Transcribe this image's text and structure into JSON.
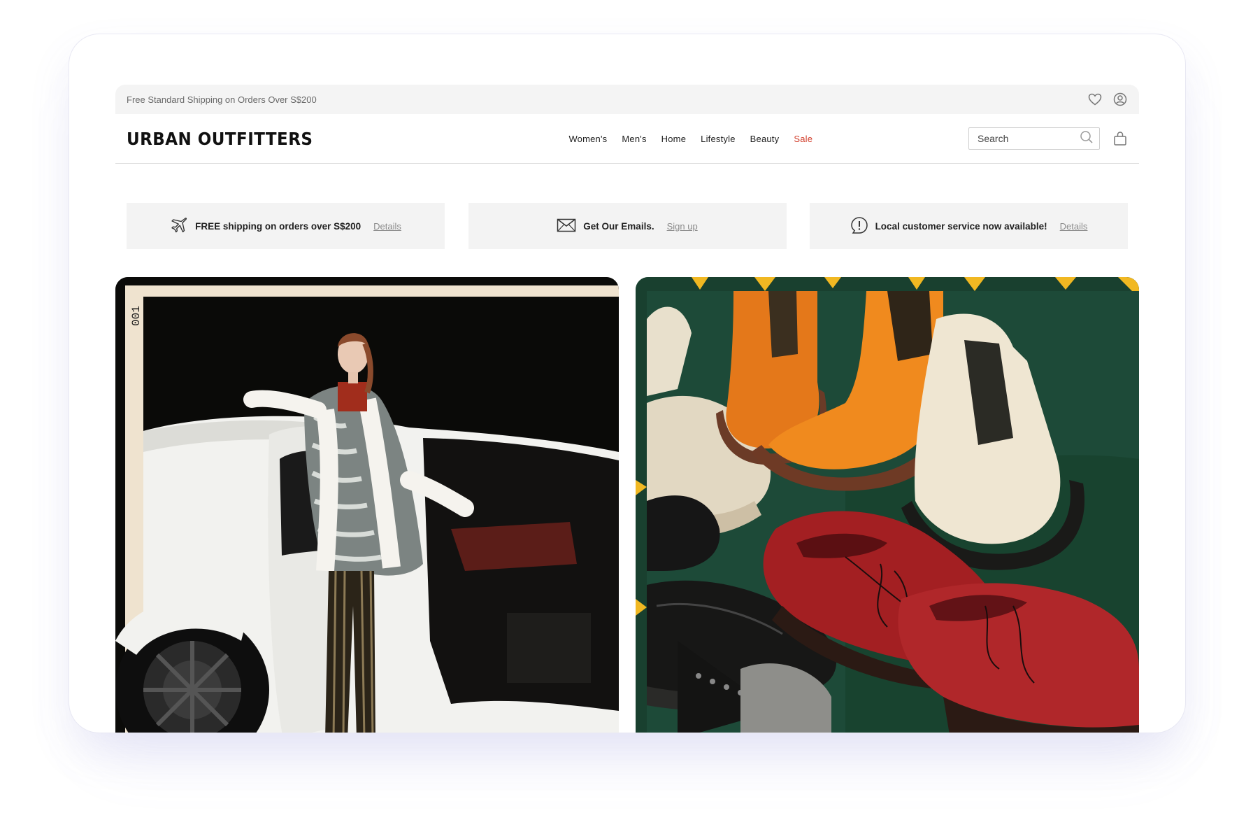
{
  "announcement": {
    "text": "Free Standard Shipping on Orders Over S$200"
  },
  "header": {
    "logo": "URBAN OUTFITTERS",
    "nav": [
      {
        "label": "Women's"
      },
      {
        "label": "Men's"
      },
      {
        "label": "Home"
      },
      {
        "label": "Lifestyle"
      },
      {
        "label": "Beauty"
      },
      {
        "label": "Sale",
        "highlight": true
      }
    ],
    "search": {
      "placeholder": "Search"
    },
    "icons": [
      "heart-icon",
      "account-icon",
      "search-icon",
      "shopping-bag-icon"
    ]
  },
  "promos": [
    {
      "icon": "airplane-icon",
      "text": "FREE shipping on orders over S$200",
      "link": "Details"
    },
    {
      "icon": "envelope-icon",
      "text": "Get Our Emails.",
      "link": "Sign up"
    },
    {
      "icon": "alert-bubble-icon",
      "text": "Local customer service now available!",
      "link": "Details"
    }
  ],
  "heroes": [
    {
      "name": "fashion-photo",
      "film_label": "001"
    },
    {
      "name": "shoes-photo"
    }
  ],
  "colors": {
    "sale": "#d2402e",
    "promo_bg": "#f3f3f3",
    "topbar_bg": "#f4f4f4",
    "shoe_bg": "#1c4a36"
  }
}
